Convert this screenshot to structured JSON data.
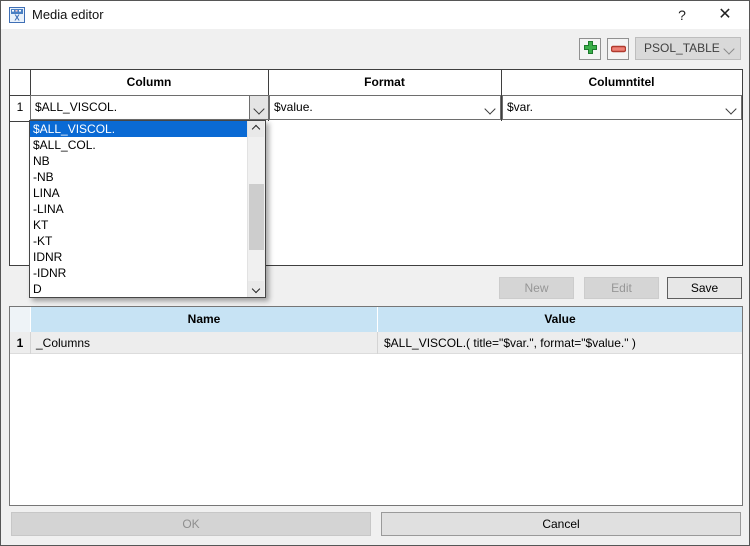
{
  "window": {
    "title": "Media editor",
    "help_label": "?",
    "close_label": "✕"
  },
  "toolbar": {
    "add_icon": "plus-icon",
    "remove_icon": "minus-icon",
    "table_select_value": "PSOL_TABLE"
  },
  "columns_grid": {
    "headers": {
      "column": "Column",
      "format": "Format",
      "columntitle": "Columntitel"
    },
    "rows": [
      {
        "num": "1",
        "column": "$ALL_VISCOL.",
        "format": "$value.",
        "columntitle": "$var."
      }
    ]
  },
  "dropdown": {
    "selected_index": 0,
    "items": [
      "$ALL_VISCOL.",
      "$ALL_COL.",
      "NB",
      "-NB",
      "LINA",
      "-LINA",
      "KT",
      "-KT",
      "IDNR",
      "-IDNR",
      "D"
    ]
  },
  "actions": {
    "new_label": "New",
    "edit_label": "Edit",
    "save_label": "Save"
  },
  "props_grid": {
    "headers": {
      "name": "Name",
      "value": "Value"
    },
    "rows": [
      {
        "num": "1",
        "name": "_Columns",
        "value": "$ALL_VISCOL.( title=\"$var.\", format=\"$value.\" )"
      }
    ]
  },
  "footer": {
    "ok_label": "OK",
    "cancel_label": "Cancel"
  },
  "colors": {
    "selection": "#0a6ad4",
    "grid_header_blue": "#c7e3f4",
    "plus_green": "#3aae49",
    "minus_red": "#c0392b",
    "dialog_bg": "#f0f0f0"
  }
}
